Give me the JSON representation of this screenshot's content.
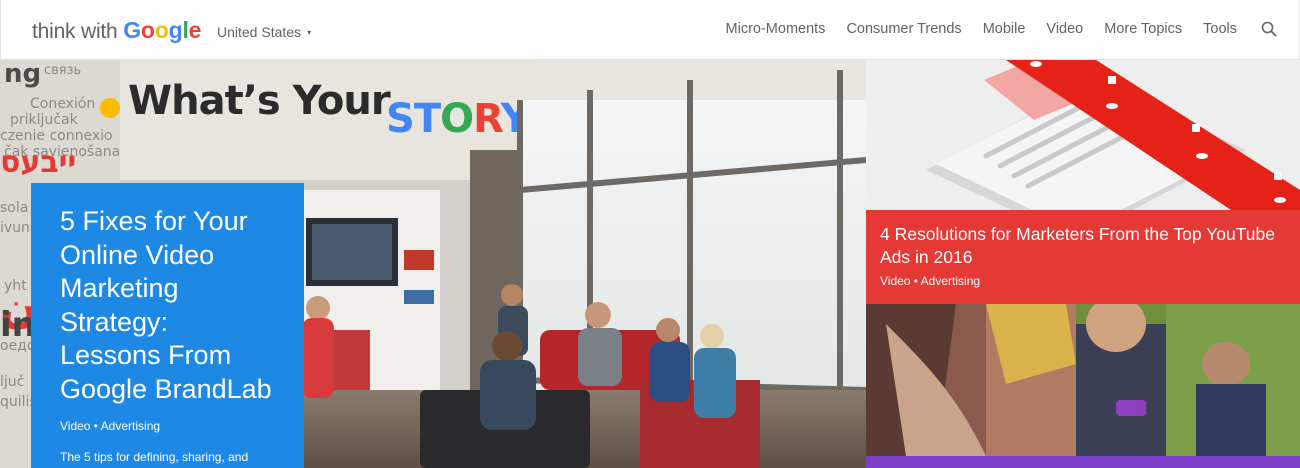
{
  "header": {
    "logo": {
      "prefix": "think with ",
      "brand": [
        "G",
        "o",
        "o",
        "g",
        "l",
        "e"
      ]
    },
    "region": {
      "label": "United States",
      "caret": "▾"
    },
    "nav": [
      "Micro-Moments",
      "Consumer Trends",
      "Mobile",
      "Video",
      "More Topics",
      "Tools"
    ],
    "search_icon": "search-icon"
  },
  "hero": {
    "banner_text": "What's Your STORY?",
    "title": "5 Fixes for Your Online Video Marketing Strategy: Lessons From Google BrandLab",
    "tags": "Video • Advertising",
    "description": "The 5 tips for defining, sharing, and"
  },
  "side": {
    "card1": {
      "title": "4 Resolutions for Marketers From the Top YouTube Ads in 2016",
      "tags": "Video • Advertising"
    }
  },
  "colors": {
    "hero_card": "#1e88e5",
    "card1_bg": "#e53935",
    "card3_bg": "#7e3fcb",
    "google_blue": "#4285f4",
    "google_red": "#ea4335",
    "google_yellow": "#fbbc05",
    "google_green": "#34a853"
  }
}
